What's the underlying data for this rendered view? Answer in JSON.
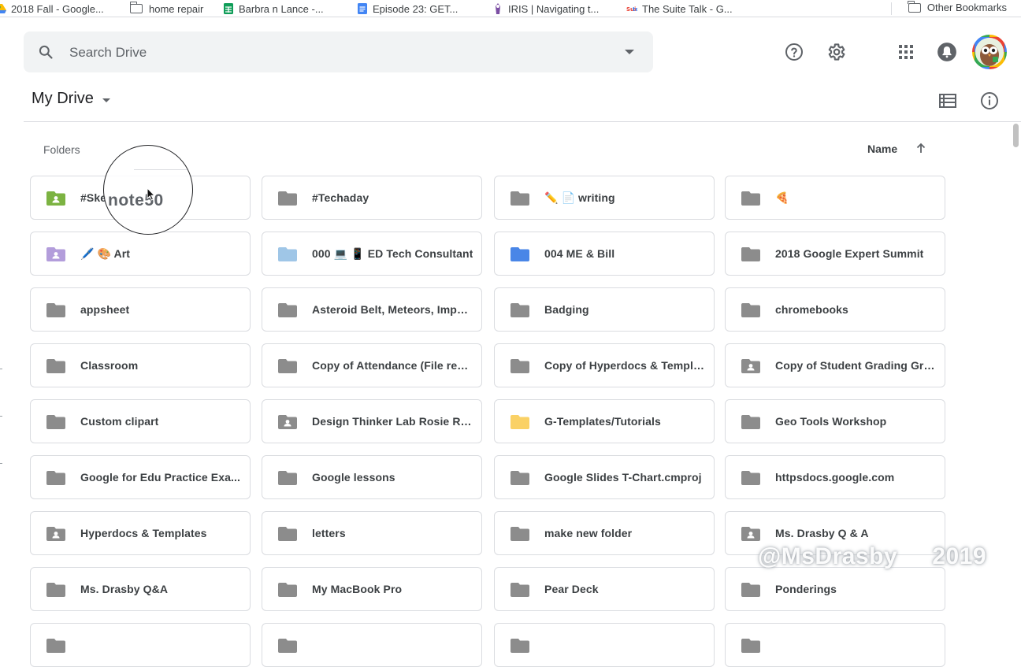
{
  "bookmarks": {
    "items": [
      {
        "label": "2018 Fall - Google...",
        "icon": "google-drive-icon"
      },
      {
        "label": "home repair",
        "icon": "folder-icon"
      },
      {
        "label": "Barbra n Lance -...",
        "icon": "google-sheets-icon"
      },
      {
        "label": "Episode 23: GET...",
        "icon": "google-docs-icon"
      },
      {
        "label": "IRIS | Navigating t...",
        "icon": "iris-icon"
      },
      {
        "label": "The Suite Talk - G...",
        "icon": "suite-talk-icon"
      }
    ],
    "other": "Other Bookmarks"
  },
  "search": {
    "placeholder": "Search Drive"
  },
  "header": {
    "help_icon": "help-icon",
    "settings_icon": "gear-icon",
    "apps_icon": "apps-grid-icon",
    "notifications_icon": "notifications-icon"
  },
  "drive": {
    "title": "My Drive",
    "section": "Folders",
    "sort_label": "Name",
    "view_toggle_icon": "list-view-icon",
    "info_icon": "info-icon"
  },
  "folders": [
    {
      "name": "#Ske",
      "type": "shared",
      "color": "#7cb342"
    },
    {
      "name": "#Techaday",
      "type": "plain",
      "color": "#8c8c8c"
    },
    {
      "name": "✏️ 📄 writing",
      "type": "plain",
      "color": "#8c8c8c"
    },
    {
      "name": "🍕",
      "type": "plain",
      "color": "#8c8c8c"
    },
    {
      "name": "🖊️ 🎨 Art",
      "type": "shared",
      "color": "#b39ddb"
    },
    {
      "name": "000 💻 📱 ED Tech Consultant",
      "type": "plain",
      "color": "#9fc6e7"
    },
    {
      "name": "004 ME & Bill",
      "type": "plain",
      "color": "#4986e7"
    },
    {
      "name": "2018 Google Expert Summit",
      "type": "plain",
      "color": "#8c8c8c"
    },
    {
      "name": "appsheet",
      "type": "plain",
      "color": "#8c8c8c"
    },
    {
      "name": "Asteroid Belt, Meteors, Impac...",
      "type": "plain",
      "color": "#8c8c8c"
    },
    {
      "name": "Badging",
      "type": "plain",
      "color": "#8c8c8c"
    },
    {
      "name": "chromebooks",
      "type": "plain",
      "color": "#8c8c8c"
    },
    {
      "name": "Classroom",
      "type": "plain",
      "color": "#8c8c8c"
    },
    {
      "name": "Copy of Attendance (File resp...",
      "type": "plain",
      "color": "#8c8c8c"
    },
    {
      "name": "Copy of Hyperdocs & Templa...",
      "type": "plain",
      "color": "#8c8c8c"
    },
    {
      "name": "Copy of Student Grading Gra...",
      "type": "shared",
      "color": "#8c8c8c"
    },
    {
      "name": "Custom clipart",
      "type": "plain",
      "color": "#8c8c8c"
    },
    {
      "name": "Design Thinker Lab Rosie Rev...",
      "type": "shared",
      "color": "#8c8c8c"
    },
    {
      "name": "G-Templates/Tutorials",
      "type": "plain",
      "color": "#fad165"
    },
    {
      "name": "Geo Tools Workshop",
      "type": "plain",
      "color": "#8c8c8c"
    },
    {
      "name": "Google for Edu Practice Exa...",
      "type": "plain",
      "color": "#8c8c8c"
    },
    {
      "name": "Google lessons",
      "type": "plain",
      "color": "#8c8c8c"
    },
    {
      "name": "Google Slides T-Chart.cmproj",
      "type": "plain",
      "color": "#8c8c8c"
    },
    {
      "name": "httpsdocs.google.com",
      "type": "plain",
      "color": "#8c8c8c"
    },
    {
      "name": "Hyperdocs & Templates",
      "type": "shared",
      "color": "#8c8c8c"
    },
    {
      "name": "letters",
      "type": "plain",
      "color": "#8c8c8c"
    },
    {
      "name": "make new folder",
      "type": "plain",
      "color": "#8c8c8c"
    },
    {
      "name": "Ms. Drasby Q & A",
      "type": "shared",
      "color": "#8c8c8c"
    },
    {
      "name": "Ms. Drasby Q&A",
      "type": "plain",
      "color": "#8c8c8c"
    },
    {
      "name": "My MacBook Pro",
      "type": "plain",
      "color": "#8c8c8c"
    },
    {
      "name": "Pear Deck",
      "type": "plain",
      "color": "#8c8c8c"
    },
    {
      "name": "Ponderings",
      "type": "plain",
      "color": "#8c8c8c"
    },
    {
      "name": "",
      "type": "plain",
      "color": "#8c8c8c"
    },
    {
      "name": "",
      "type": "plain",
      "color": "#8c8c8c"
    },
    {
      "name": "",
      "type": "plain",
      "color": "#8c8c8c"
    },
    {
      "name": "",
      "type": "plain",
      "color": "#8c8c8c"
    }
  ],
  "overlay": {
    "magnifier_text": "note50",
    "watermark": "@MsDrasby     2019"
  }
}
